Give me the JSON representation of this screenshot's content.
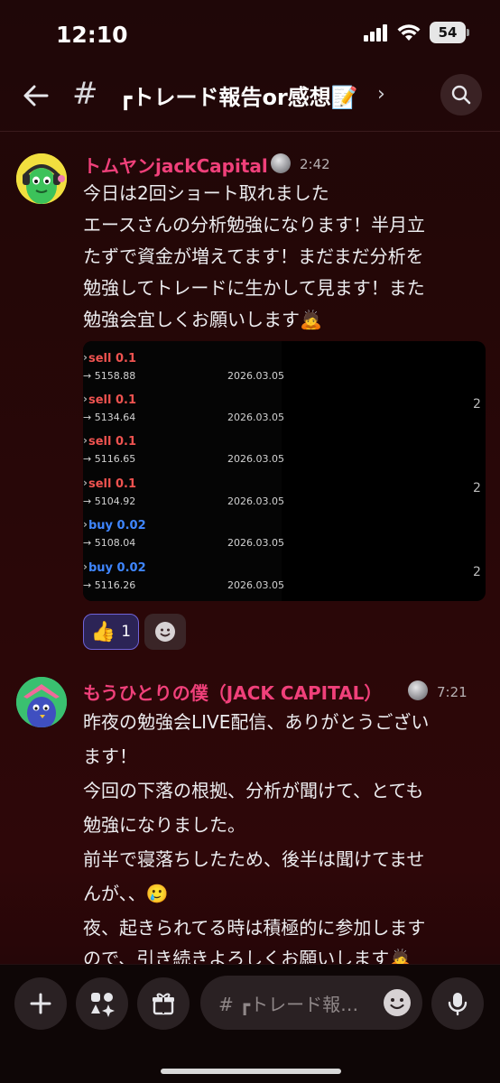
{
  "status_bar": {
    "time": "12:10",
    "battery": "54"
  },
  "header": {
    "channel_title": "┏トレード報告or感想📝"
  },
  "messages": [
    {
      "username": "トムヤンjackCapital",
      "timestamp": "2:42",
      "lines": [
        "今日は2回ショート取れました",
        "エースさんの分析勉強になります！半月立",
        "たずで資金が増えてます！まだまだ分析を",
        "勉強してトレードに生かして見ます！また",
        "勉強会宜しくお願いします🙇"
      ],
      "attachment": {
        "trades": [
          {
            "side": "sell 0.1",
            "type": "sell",
            "price": "→ 5158.88",
            "date": "2026.03.05"
          },
          {
            "side": "sell 0.1",
            "type": "sell",
            "price": "→ 5134.64",
            "date": "2026.03.05"
          },
          {
            "side": "sell 0.1",
            "type": "sell",
            "price": "→ 5116.65",
            "date": "2026.03.05"
          },
          {
            "side": "sell 0.1",
            "type": "sell",
            "price": "→ 5104.92",
            "date": "2026.03.05"
          },
          {
            "side": "buy 0.02",
            "type": "buy",
            "price": "→ 5108.04",
            "date": "2026.03.05"
          },
          {
            "side": "buy 0.02",
            "type": "buy",
            "price": "→ 5116.26",
            "date": "2026.03.05"
          }
        ],
        "cutoff_digit": "2"
      },
      "reactions": [
        {
          "emoji": "👍",
          "count": "1"
        }
      ]
    },
    {
      "username": "もうひとりの僕（JACK CAPITAL）",
      "timestamp": "7:21",
      "lines": [
        "昨夜の勉強会LIVE配信、ありがとうござい",
        "ます！",
        "今回の下落の根拠、分析が聞けて、とても",
        "勉強になりました。",
        "前半で寝落ちしたため、後半は聞けてませ",
        "んが、、🥲",
        "夜、起きられてる時は積極的に参加します",
        "ので、引き続きよろしくお願いします🙇"
      ]
    }
  ],
  "composer": {
    "placeholder": "# ┏トレード報…"
  },
  "colors": {
    "username": "#f0407a",
    "reaction_bg": "#2c2456",
    "reaction_border": "#6f63d8"
  }
}
